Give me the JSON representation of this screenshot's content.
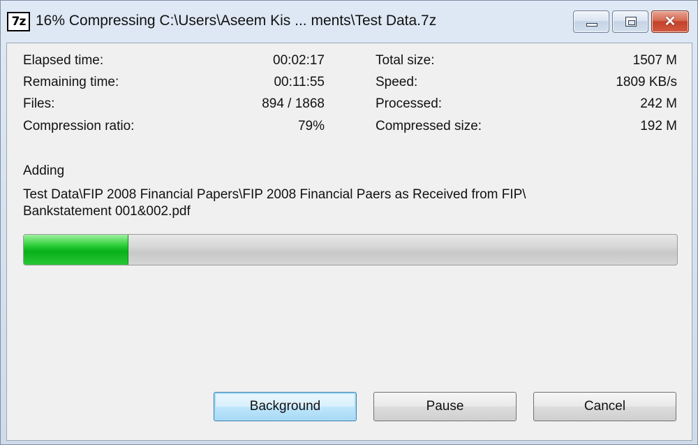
{
  "window": {
    "icon_text": "7z",
    "title": "16% Compressing C:\\Users\\Aseem Kis ... ments\\Test Data.7z"
  },
  "stats_left": [
    {
      "label": "Elapsed time:",
      "value": "00:02:17"
    },
    {
      "label": "Remaining time:",
      "value": "00:11:55"
    },
    {
      "label": "Files:",
      "value": "894 / 1868"
    },
    {
      "label": "Compression ratio:",
      "value": "79%"
    }
  ],
  "stats_right": [
    {
      "label": "Total size:",
      "value": "1507 M"
    },
    {
      "label": "Speed:",
      "value": "1809 KB/s"
    },
    {
      "label": "Processed:",
      "value": "242 M"
    },
    {
      "label": "Compressed size:",
      "value": "192 M"
    }
  ],
  "activity": {
    "label": "Adding",
    "path_line1": "Test Data\\FIP 2008 Financial Papers\\FIP 2008 Financial Paers as Received from FIP\\",
    "path_line2": "Bankstatement 001&002.pdf"
  },
  "progress": {
    "fraction": 0.16,
    "color": "#08b019"
  },
  "buttons": {
    "background": "Background",
    "pause": "Pause",
    "cancel": "Cancel"
  }
}
